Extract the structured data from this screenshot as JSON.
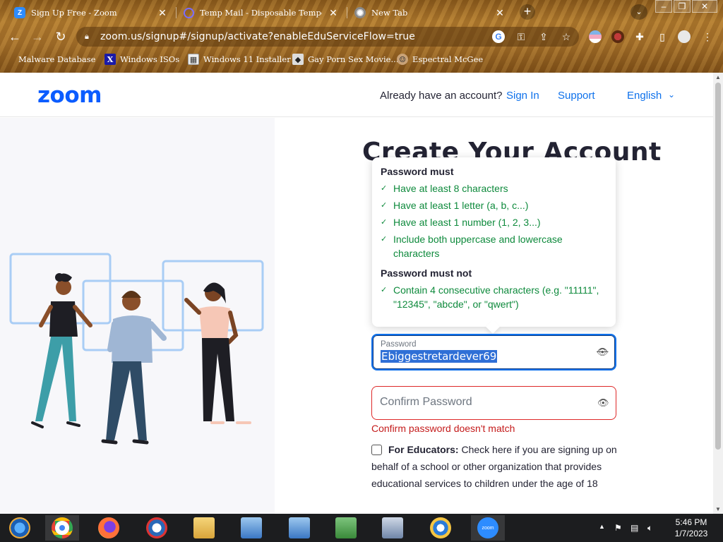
{
  "browser": {
    "tabs": [
      {
        "title": "Sign Up Free - Zoom",
        "icon": "zoom-tab-icon"
      },
      {
        "title": "Temp Mail - Disposable Temporar",
        "icon": "tempmail-tab-icon"
      },
      {
        "title": "New Tab",
        "icon": "chrome-tab-icon"
      }
    ],
    "new_tab_label": "+",
    "url": "zoom.us/signup#/signup/activate?enableEduServiceFlow=true",
    "bookmarks": [
      {
        "label": "Malware Database",
        "icon": "folder-icon"
      },
      {
        "label": "Windows ISOs",
        "icon": "x-icon"
      },
      {
        "label": "Windows 11 Installer",
        "icon": "image-icon"
      },
      {
        "label": "Gay Porn Sex Movie...",
        "icon": "site-icon"
      },
      {
        "label": "Espectral McGee",
        "icon": "avatar-icon"
      }
    ]
  },
  "header": {
    "logo": "zoom",
    "already_text": "Already have an account?",
    "sign_in": "Sign In",
    "support": "Support",
    "language": "English"
  },
  "form": {
    "title": "Create Your Account",
    "tooltip": {
      "must_heading": "Password must",
      "must_rules": [
        "Have at least 8 characters",
        "Have at least 1 letter (a, b, c...)",
        "Have at least 1 number (1, 2, 3...)",
        "Include both uppercase and lowercase characters"
      ],
      "must_not_heading": "Password must not",
      "must_not_rules": [
        "Contain 4 consecutive characters (e.g. \"11111\", \"12345\", \"abcde\", or \"qwert\")"
      ]
    },
    "password_label": "Password",
    "password_value": "Ebiggestretardever69",
    "confirm_placeholder": "Confirm Password",
    "confirm_error": "Confirm password doesn't match",
    "edu_bold": "For Educators:",
    "edu_text": " Check here if you are signing up on behalf of a school or other organization that provides educational services to children under the age of 18"
  },
  "taskbar": {
    "time": "5:46 PM",
    "date": "1/7/2023"
  },
  "colors": {
    "zoom_blue": "#0b5cff",
    "link_blue": "#0e71eb",
    "success_green": "#0e8a3c",
    "error_red": "#c41b1b"
  }
}
